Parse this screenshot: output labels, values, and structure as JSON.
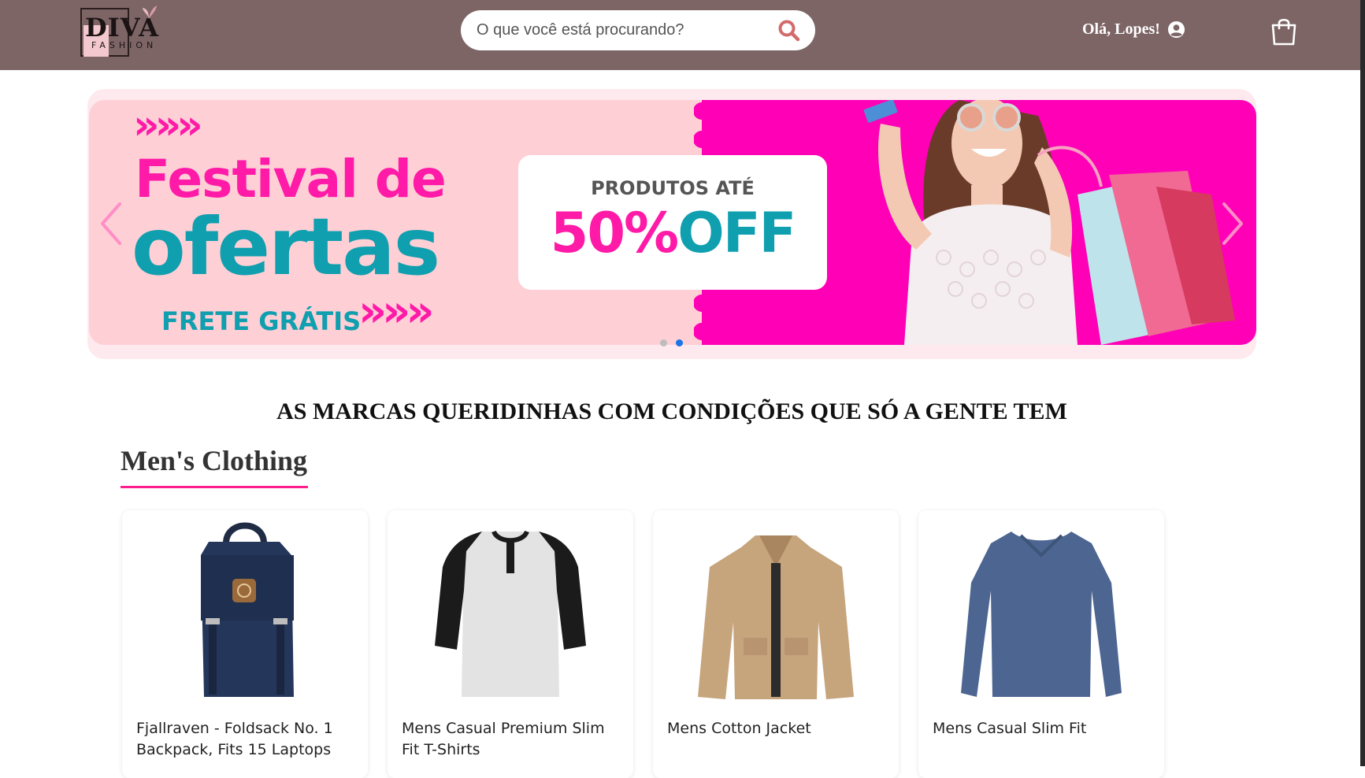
{
  "header": {
    "logo_text": "DIVA",
    "logo_sub": "FASHION",
    "search_placeholder": "O que você está procurando?",
    "greeting": "Olá, Lopes!",
    "colors": {
      "bar": "#7d6566",
      "accent": "#ff1e8e"
    },
    "icons": {
      "search": "search-icon",
      "user": "user-circle-icon",
      "cart": "shopping-bag-icon"
    }
  },
  "banner": {
    "line1": "Festival de",
    "line2": "ofertas",
    "shipping": "FRETE GRÁTIS",
    "card_top": "PRODUTOS ATÉ",
    "card_pct": "50%",
    "card_off": "OFF",
    "arrows": "»»»",
    "active_slide": 2,
    "slide_count": 2,
    "colors": {
      "pink": "#ff1aa7",
      "teal": "#0f9fae",
      "light": "#ffcfd6",
      "magenta": "#ff00b7"
    }
  },
  "main": {
    "section_title": "AS MARCAS QUERIDINHAS COM CONDIÇÕES QUE SÓ A GENTE TEM",
    "category": "Men's Clothing",
    "products": [
      {
        "name": "Fjallraven - Foldsack No. 1 Backpack, Fits 15 Laptops",
        "image": "backpack"
      },
      {
        "name": "Mens Casual Premium Slim Fit T-Shirts",
        "image": "raglan-tshirt"
      },
      {
        "name": "Mens Cotton Jacket",
        "image": "jacket"
      },
      {
        "name": "Mens Casual Slim Fit",
        "image": "long-sleeve-shirt"
      }
    ]
  }
}
